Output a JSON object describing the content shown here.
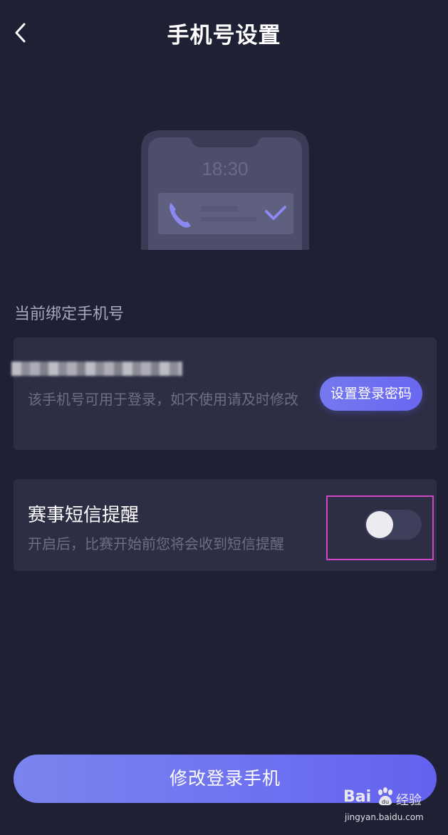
{
  "header": {
    "title": "手机号设置"
  },
  "illustration": {
    "time": "18:30"
  },
  "phone_section": {
    "label": "当前绑定手机号",
    "description": "该手机号可用于登录，如不使用请及时修改",
    "set_password_button": "设置登录密码"
  },
  "sms_section": {
    "title": "赛事短信提醒",
    "description": "开启后，比赛开始前您将会收到短信提醒",
    "toggle_on": false
  },
  "footer": {
    "change_phone_button": "修改登录手机"
  },
  "watermark": {
    "brand_left": "Bai",
    "brand_right": "经验",
    "url": "jingyan.baidu.com"
  },
  "colors": {
    "background": "#202034",
    "card": "#2d2e44",
    "accent": "#6f73f0",
    "highlight": "#cf46c6"
  }
}
